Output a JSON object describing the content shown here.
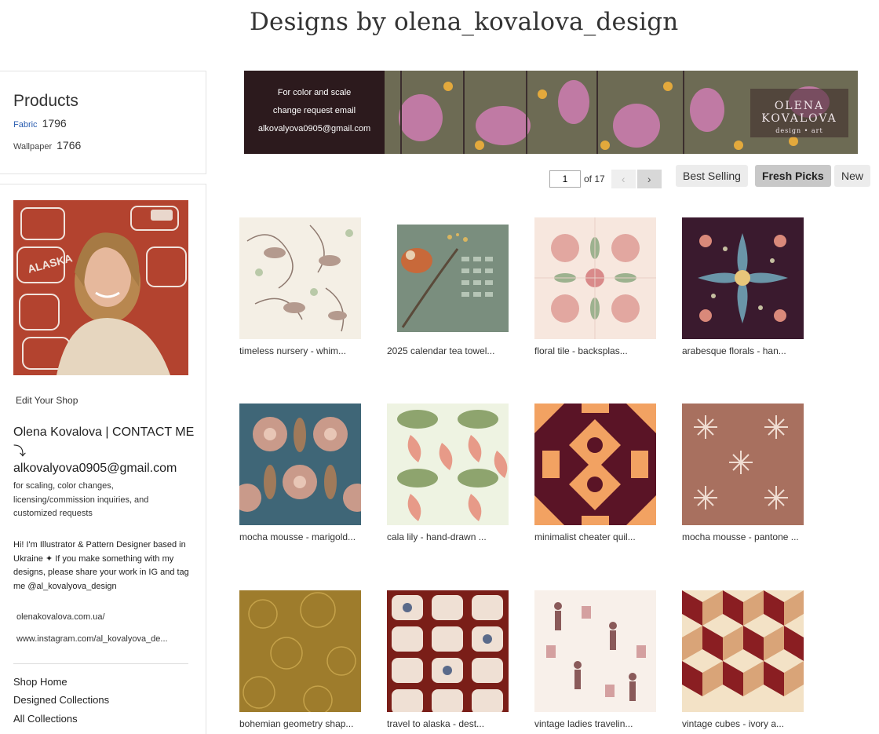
{
  "page": {
    "title": "Designs by olena_kovalova_design"
  },
  "products": {
    "heading": "Products",
    "items": [
      {
        "label": "Fabric",
        "count": "1796"
      },
      {
        "label": "Wallpaper",
        "count": "1766"
      }
    ]
  },
  "shop": {
    "edit_label": "Edit Your Shop",
    "heading": "Olena Kovalova | CONTACT ME ⤵",
    "email": "alkovalyova0905@gmail.com",
    "note": "for scaling, color changes, licensing/commission inquiries, and customized requests",
    "bio": "Hi! I'm Illustrator & Pattern Designer based in Ukraine ✦ If you make something with my designs, please share your work in IG and tag me @al_kovalyova_design",
    "links": [
      "olenakovalova.com.ua/",
      "www.instagram.com/al_kovalyova_de..."
    ],
    "nav": [
      "Shop Home",
      "Designed Collections",
      "All Collections"
    ]
  },
  "banner": {
    "line1": "For color and scale",
    "line2": "change request email",
    "line3": "alkovalyova0905@gmail.com",
    "logo_line1": "OLENA KOVALOVA",
    "logo_line2": "design • art"
  },
  "pager": {
    "current": "1",
    "of_label": "of 17",
    "prev_icon": "‹",
    "next_icon": "›"
  },
  "sort": [
    "Best Selling",
    "Fresh Picks",
    "New"
  ],
  "designs": [
    {
      "caption": "timeless nursery - whim..."
    },
    {
      "caption": "2025 calendar tea towel..."
    },
    {
      "caption": "floral tile - backsplas..."
    },
    {
      "caption": "arabesque florals - han..."
    },
    {
      "caption": "mocha mousse - marigold..."
    },
    {
      "caption": "cala lily - hand-drawn ..."
    },
    {
      "caption": "minimalist cheater quil..."
    },
    {
      "caption": "mocha mousse - pantone ..."
    },
    {
      "caption": "bohemian geometry shap..."
    },
    {
      "caption": "travel to alaska - dest..."
    },
    {
      "caption": "vintage ladies travelin..."
    },
    {
      "caption": "vintage cubes - ivory a..."
    }
  ]
}
